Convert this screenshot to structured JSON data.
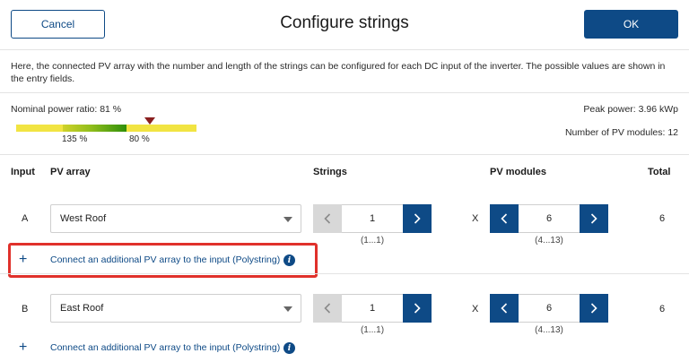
{
  "header": {
    "cancel_label": "Cancel",
    "title": "Configure strings",
    "ok_label": "OK"
  },
  "description": "Here, the connected PV array with the number and length of the strings can be configured for each DC input of the inverter. The possible values are shown in the entry fields.",
  "summary": {
    "nominal_power_ratio": "Nominal power ratio: 81 %",
    "peak_power": "Peak power: 3.96 kWp",
    "num_modules": "Number of PV modules: 12",
    "ratio_scale": {
      "left_label": "135 %",
      "right_label": "80 %"
    }
  },
  "columns": {
    "input": "Input",
    "pv_array": "PV array",
    "strings": "Strings",
    "pv_modules": "PV modules",
    "total": "Total"
  },
  "inputs": [
    {
      "id": "A",
      "pv_array": "West Roof",
      "strings": "1",
      "strings_range": "(1...1)",
      "x": "X",
      "modules": "6",
      "modules_range": "(4...13)",
      "total": "6",
      "polystring_link": "Connect an additional PV array to the input (Polystring)"
    },
    {
      "id": "B",
      "pv_array": "East Roof",
      "strings": "1",
      "strings_range": "(1...1)",
      "x": "X",
      "modules": "6",
      "modules_range": "(4...13)",
      "total": "6",
      "polystring_link": "Connect an additional PV array to the input (Polystring)"
    }
  ],
  "icons": {
    "dropdown": "chevron-down-icon",
    "decrement": "chevron-left-icon",
    "increment": "chevron-right-icon",
    "add": "plus-icon",
    "info": "info-icon"
  },
  "colors": {
    "primary": "#0e4a86",
    "highlight": "#e0312b",
    "ratio_yellow": "#f1e442",
    "ratio_green": "#2f8f0a",
    "marker": "#8a1f1f"
  }
}
